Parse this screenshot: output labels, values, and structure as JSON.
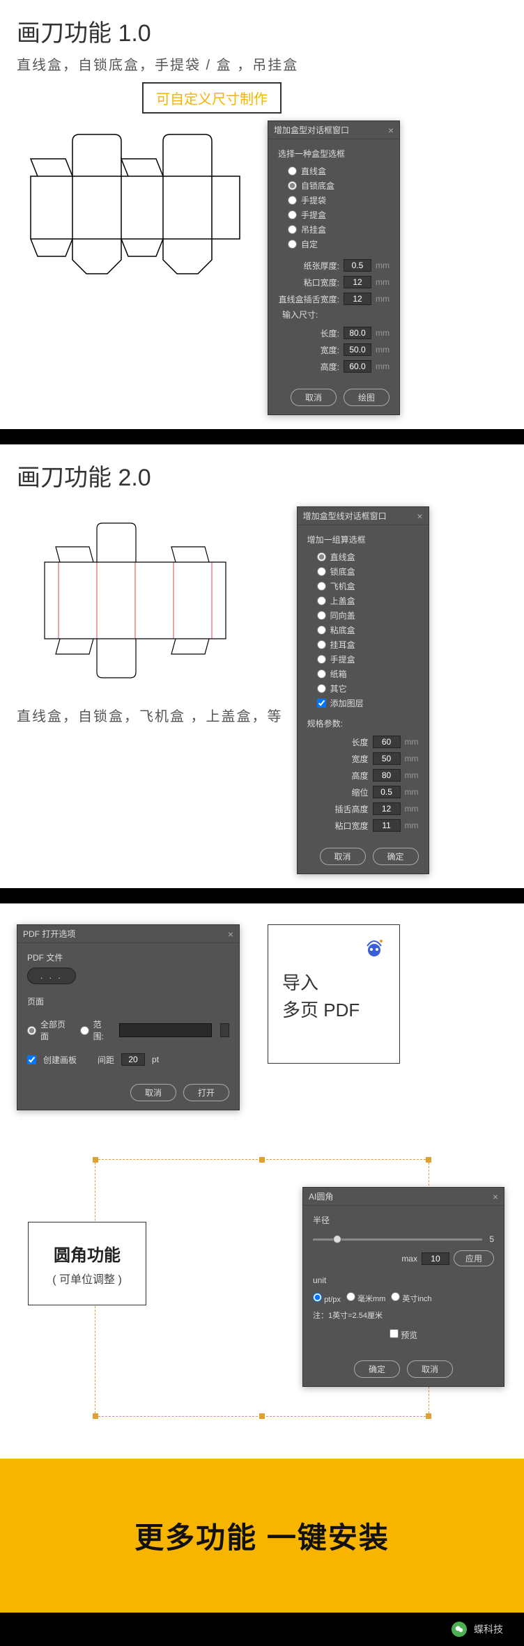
{
  "sec1": {
    "title": "画刀功能 1.0",
    "sub": "直线盒，自锁底盒，手提袋 / 盒 ，吊挂盒",
    "custom": "可自定义尺寸制作",
    "dlg": {
      "title": "增加盒型对话框窗口",
      "group": "选择一种盒型选框",
      "opts": [
        "直线盒",
        "自锁底盒",
        "手提袋",
        "手提盒",
        "吊挂盒",
        "自定"
      ],
      "selected": 1,
      "fields": [
        {
          "lbl": "纸张厚度:",
          "val": "0.5",
          "unit": "mm"
        },
        {
          "lbl": "粘口宽度:",
          "val": "12",
          "unit": "mm"
        },
        {
          "lbl": "直线盒插舌宽度:",
          "val": "12",
          "unit": "mm"
        }
      ],
      "inputHdr": "输入尺寸:",
      "dims": [
        {
          "lbl": "长度:",
          "val": "80.0",
          "unit": "mm"
        },
        {
          "lbl": "宽度:",
          "val": "50.0",
          "unit": "mm"
        },
        {
          "lbl": "高度:",
          "val": "60.0",
          "unit": "mm"
        }
      ],
      "cancel": "取消",
      "ok": "绘图"
    }
  },
  "sec2": {
    "title": "画刀功能 2.0",
    "sub": "直线盒，自锁盒，飞机盒 ，上盖盒，等",
    "dlg": {
      "title": "增加盒型线对话框窗口",
      "group": "增加一组算选框",
      "opts": [
        "直线盒",
        "锁底盒",
        "飞机盒",
        "上盖盒",
        "同向盖",
        "粘底盒",
        "挂耳盒",
        "手提盒",
        "纸箱",
        "其它"
      ],
      "selected": 0,
      "chk": "添加图层",
      "specHdr": "规格参数:",
      "dims": [
        {
          "lbl": "长度",
          "val": "60",
          "unit": "mm"
        },
        {
          "lbl": "宽度",
          "val": "50",
          "unit": "mm"
        },
        {
          "lbl": "高度",
          "val": "80",
          "unit": "mm"
        },
        {
          "lbl": "缩位",
          "val": "0.5",
          "unit": "mm"
        },
        {
          "lbl": "插舌高度",
          "val": "12",
          "unit": "mm"
        },
        {
          "lbl": "粘口宽度",
          "val": "11",
          "unit": "mm"
        }
      ],
      "cancel": "取消",
      "ok": "确定"
    }
  },
  "sec3": {
    "dlg": {
      "title": "PDF 打开选项",
      "fileLbl": "PDF 文件",
      "fileDots": ". . .",
      "pageHdr": "页面",
      "allPages": "全部页面",
      "range": "范围:",
      "createArtboard": "创建画板",
      "gapLbl": "间距",
      "gapVal": "20",
      "gapUnit": "pt",
      "cancel": "取消",
      "ok": "打开"
    },
    "card": {
      "line1": "导入",
      "line2": "多页 PDF"
    }
  },
  "sec4": {
    "card": {
      "title": "圆角功能",
      "sub": "( 可单位调整 )"
    },
    "dlg": {
      "title": "AI圆角",
      "radiusLbl": "半径",
      "sliderVal": "5",
      "maxLbl": "max",
      "maxVal": "10",
      "apply": "应用",
      "unitLbl": "unit",
      "units": [
        "pt/px",
        "毫米mm",
        "英寸inch"
      ],
      "unitNote": "注：1英寸=2.54厘米",
      "preview": "预览",
      "ok": "确定",
      "cancel": "取消"
    }
  },
  "footer": {
    "text": "更多功能  一键安装"
  },
  "wechat": {
    "name": "蝶科技"
  }
}
